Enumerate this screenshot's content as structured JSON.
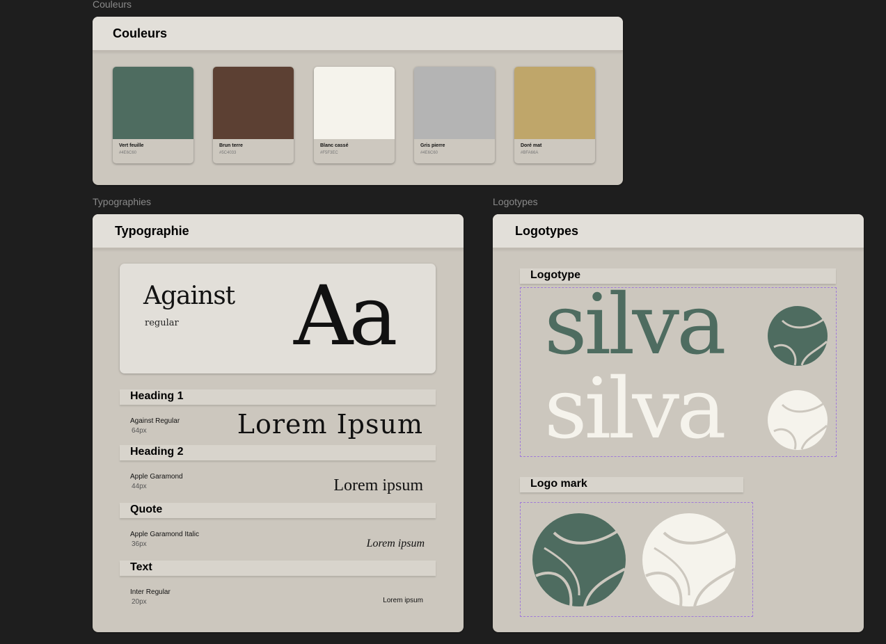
{
  "frames": {
    "colors_label": "Couleurs",
    "typo_label": "Typographies",
    "logos_label": "Logotypes"
  },
  "colors": {
    "title": "Couleurs",
    "swatches": [
      {
        "name": "Vert feuille",
        "hex": "#4E6C60",
        "color": "#4e6c60"
      },
      {
        "name": "Brun terre",
        "hex": "#5C4033",
        "color": "#5c4033"
      },
      {
        "name": "Blanc cassé",
        "hex": "#F5F3EC",
        "color": "#f5f3ec"
      },
      {
        "name": "Gris pierre",
        "hex": "#4E6C60",
        "color": "#b4b4b4"
      },
      {
        "name": "Doré mat",
        "hex": "#BFA66A",
        "color": "#bfa66a"
      }
    ]
  },
  "typography": {
    "title": "Typographie",
    "specimen": {
      "font": "Against",
      "weight": "regular",
      "glyphs": "Aa"
    },
    "styles": [
      {
        "heading": "Heading 1",
        "font": "Against Regular",
        "size": "64px",
        "sample": "Lorem Ipsum"
      },
      {
        "heading": "Heading 2",
        "font": "Apple Garamond",
        "size": "44px",
        "sample": "Lorem ipsum"
      },
      {
        "heading": "Quote",
        "font": "Apple Garamond Italic",
        "size": "36px",
        "sample": "Lorem ipsum"
      },
      {
        "heading": "Text",
        "font": "Inter Regular",
        "size": "20px",
        "sample": "Lorem ipsum"
      }
    ]
  },
  "logos": {
    "title": "Logotypes",
    "logotype_label": "Logotype",
    "wordmark": "silva",
    "logomark_label": "Logo mark",
    "green": "#4e6c60",
    "cream": "#f5f3ec"
  }
}
